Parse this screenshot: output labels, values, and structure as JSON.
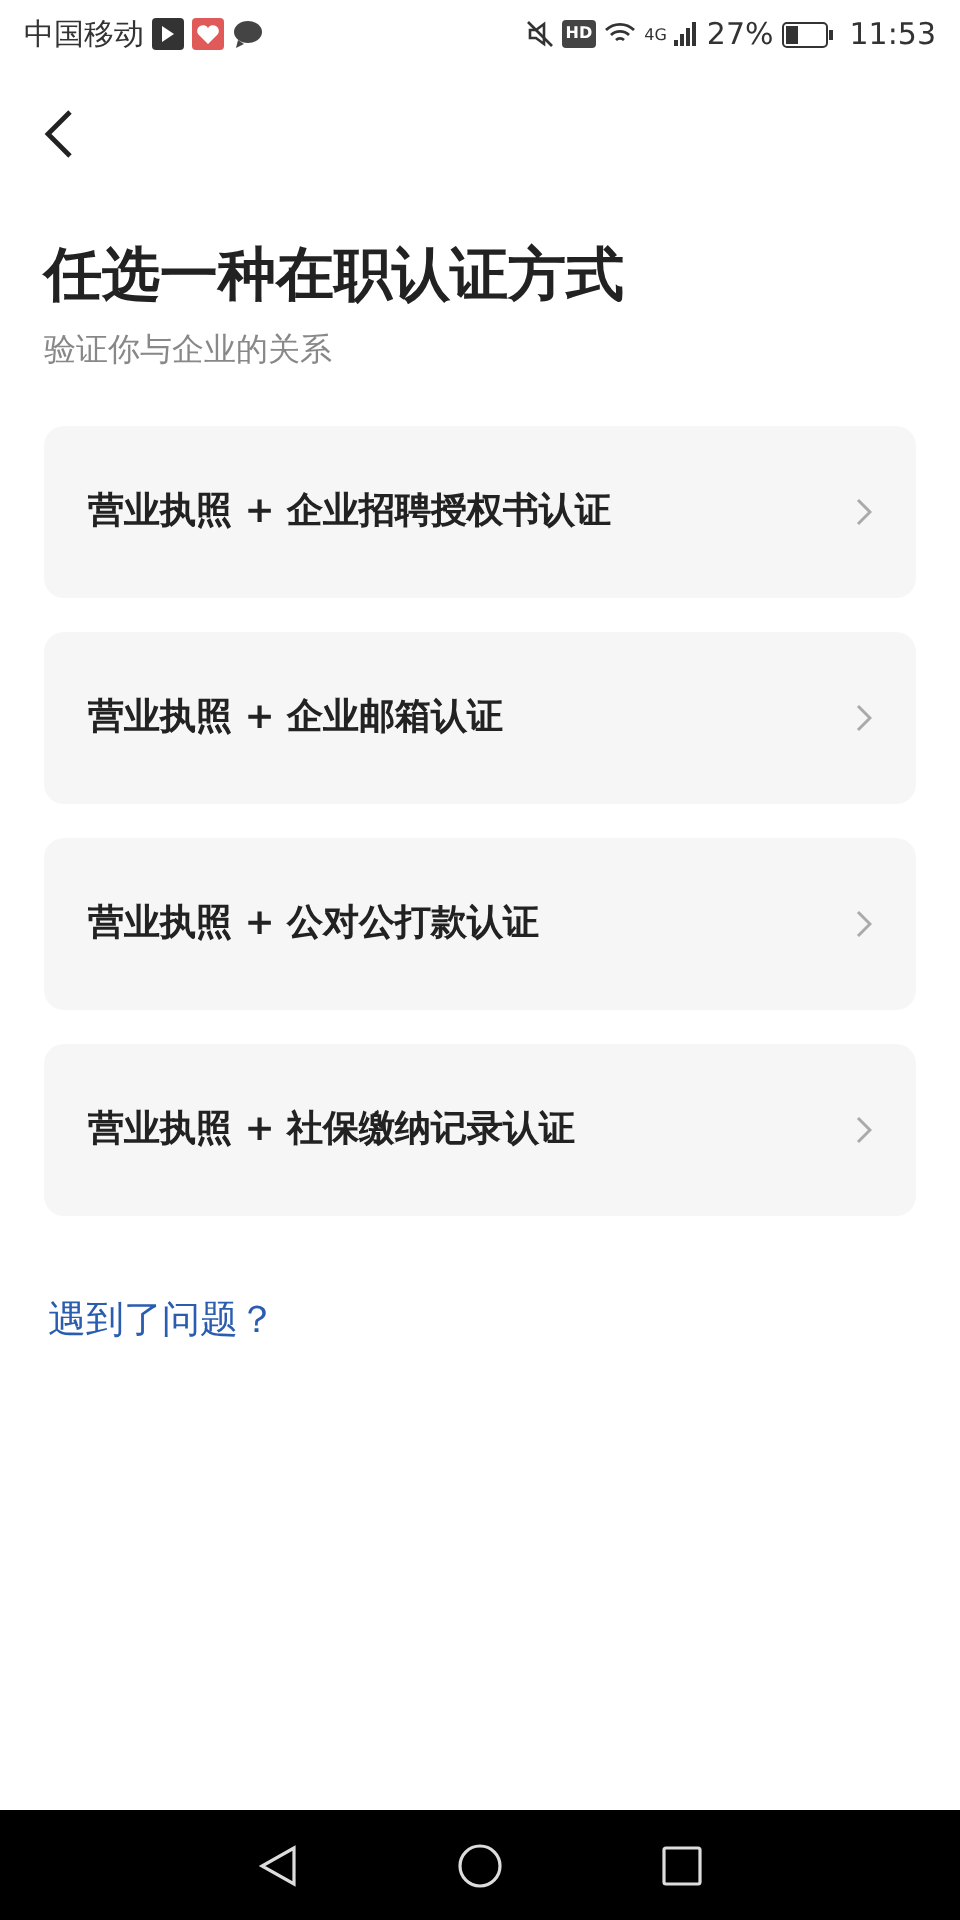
{
  "status_bar": {
    "carrier": "中国移动",
    "hd": "HD",
    "network": "4G",
    "battery": "27%",
    "time": "11:53"
  },
  "title": "任选一种在职认证方式",
  "subtitle": "验证你与企业的关系",
  "options": [
    {
      "label": "营业执照 + 企业招聘授权书认证"
    },
    {
      "label": "营业执照 + 企业邮箱认证"
    },
    {
      "label": "营业执照 + 公对公打款认证"
    },
    {
      "label": "营业执照 + 社保缴纳记录认证"
    }
  ],
  "help_link": "遇到了问题？"
}
